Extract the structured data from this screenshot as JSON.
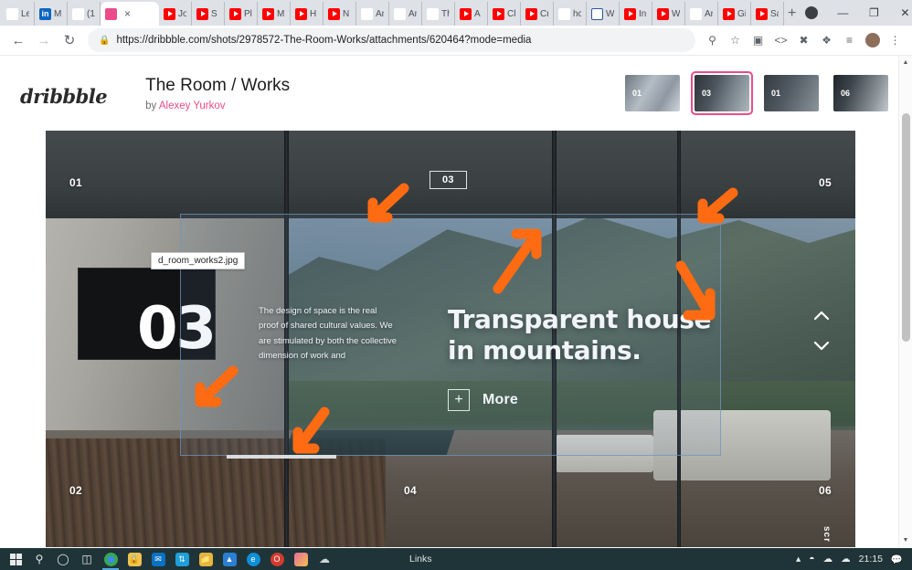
{
  "browser": {
    "tabs": [
      {
        "label": "Le",
        "icon": "gmail-icon",
        "kind": "gmail",
        "active": false
      },
      {
        "label": "M",
        "icon": "linkedin-icon",
        "kind": "li",
        "active": false
      },
      {
        "label": "(1",
        "icon": "pinterest-icon",
        "kind": "pin",
        "active": false
      },
      {
        "label": "",
        "icon": "dribbble-icon",
        "kind": "drib",
        "active": true
      },
      {
        "label": "Jo",
        "icon": "youtube-icon",
        "kind": "yt",
        "active": false
      },
      {
        "label": "S",
        "icon": "youtube-icon",
        "kind": "yt",
        "active": false
      },
      {
        "label": "Pl",
        "icon": "youtube-icon",
        "kind": "yt",
        "active": false
      },
      {
        "label": "M",
        "icon": "youtube-icon",
        "kind": "yt",
        "active": false
      },
      {
        "label": "H",
        "icon": "youtube-icon",
        "kind": "yt",
        "active": false
      },
      {
        "label": "N",
        "icon": "youtube-icon",
        "kind": "yt",
        "active": false
      },
      {
        "label": "Ar",
        "icon": "amazon-icon",
        "kind": "amz",
        "active": false
      },
      {
        "label": "Ar",
        "icon": "amazon-icon",
        "kind": "amz",
        "active": false
      },
      {
        "label": "Th",
        "icon": "amazon-icon",
        "kind": "amz",
        "active": false
      },
      {
        "label": "A",
        "icon": "youtube-icon",
        "kind": "yt",
        "active": false
      },
      {
        "label": "Cl",
        "icon": "youtube-icon",
        "kind": "yt",
        "active": false
      },
      {
        "label": "Cr",
        "icon": "youtube-icon",
        "kind": "yt",
        "active": false
      },
      {
        "label": "hc",
        "icon": "google-icon",
        "kind": "g",
        "active": false
      },
      {
        "label": "W",
        "icon": "word-icon",
        "kind": "word",
        "active": false
      },
      {
        "label": "In",
        "icon": "youtube-icon",
        "kind": "yt",
        "active": false
      },
      {
        "label": "W",
        "icon": "youtube-icon",
        "kind": "yt",
        "active": false
      },
      {
        "label": "Ar",
        "icon": "amazon-icon",
        "kind": "amz",
        "active": false
      },
      {
        "label": "Gi",
        "icon": "youtube-icon",
        "kind": "yt",
        "active": false
      },
      {
        "label": "Sa",
        "icon": "youtube-icon",
        "kind": "yt",
        "active": false
      }
    ],
    "new_tab_label": "+",
    "close_tab_label": "×",
    "window_controls": {
      "minimize": "—",
      "maximize": "❐",
      "close": "✕"
    },
    "url": "https://dribbble.com/shots/2978572-The-Room-Works/attachments/620464?mode=media",
    "nav": {
      "back": "←",
      "forward": "→",
      "reload": "↻"
    },
    "lock": "🔒",
    "toolbar_icons": [
      "zoom-icon",
      "bookmark-star-icon",
      "screenshot-icon",
      "code-icon",
      "puzzle-colored-icon",
      "extensions-icon",
      "reading-list-icon",
      "profile-avatar-icon",
      "more-menu-icon"
    ]
  },
  "site": {
    "logo": "dribbble",
    "shot_title": "The Room / Works",
    "by_prefix": "by ",
    "author": "Alexey Yurkov",
    "accent_color": "#ea4c89",
    "thumbnails": [
      {
        "number": "01",
        "selected": false
      },
      {
        "number": "03",
        "selected": true
      },
      {
        "number": "01",
        "selected": false
      },
      {
        "number": "06",
        "selected": false
      }
    ]
  },
  "shot": {
    "file_tooltip": "d_room_works2.jpg",
    "corner_numbers": {
      "top_left": "01",
      "top_center": "03",
      "top_right": "05",
      "bottom_left": "02",
      "bottom_center": "04",
      "bottom_right": "06"
    },
    "big_number": "03",
    "body_copy": "The design of space is the real proof of shared cultural values. We are stimulated by both the collective dimension of work and",
    "headline_line1": "Transparent house",
    "headline_line2": "in mountains.",
    "more_plus": "+",
    "more_label": "More",
    "chevron_up": "⌃",
    "chevron_down": "⌄",
    "scroll_label": "scr",
    "annotation_color": "#ff6b12"
  },
  "taskbar": {
    "start": "start-icon",
    "items": [
      "search-icon",
      "cortana-icon",
      "task-view-icon",
      "chrome-icon",
      "store-icon",
      "mail-icon",
      "sync-icon",
      "file-explorer-icon",
      "app-blue-icon",
      "edge-icon",
      "opera-icon",
      "photos-icon",
      "onedrive-icon"
    ],
    "links_label": "Links",
    "time": "21:15",
    "tray": [
      "chevron-up-icon",
      "wifi-icon",
      "cloud-icon",
      "onedrive-icon"
    ],
    "notification": "notification-icon"
  }
}
